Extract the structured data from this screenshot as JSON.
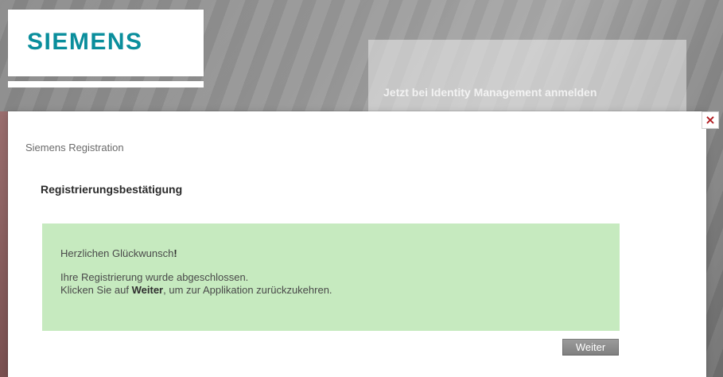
{
  "background": {
    "brand": {
      "name": "SIEMENS",
      "color": "#0A8E9C"
    },
    "top_panel_text": "Jetzt bei Identity Management anmelden"
  },
  "modal": {
    "title": "Siemens Registration",
    "heading": "Registrierungsbestätigung",
    "close_label": "×",
    "success": {
      "line1_prefix": "Herzlichen Glückwunsch",
      "line1_suffix": "!",
      "line2": "Ihre Registrierung wurde abgeschlossen.",
      "line3_prefix": "Klicken Sie auf ",
      "line3_bold": "Weiter",
      "line3_suffix": ", um zur Applikation zurückzukehren."
    },
    "primary_button_label": "Weiter"
  },
  "colors": {
    "success_bg": "#C6EABF",
    "button_bg": "#8C8C8C",
    "close_x": "#B0191E"
  },
  "icons": {
    "close": "close-icon"
  }
}
